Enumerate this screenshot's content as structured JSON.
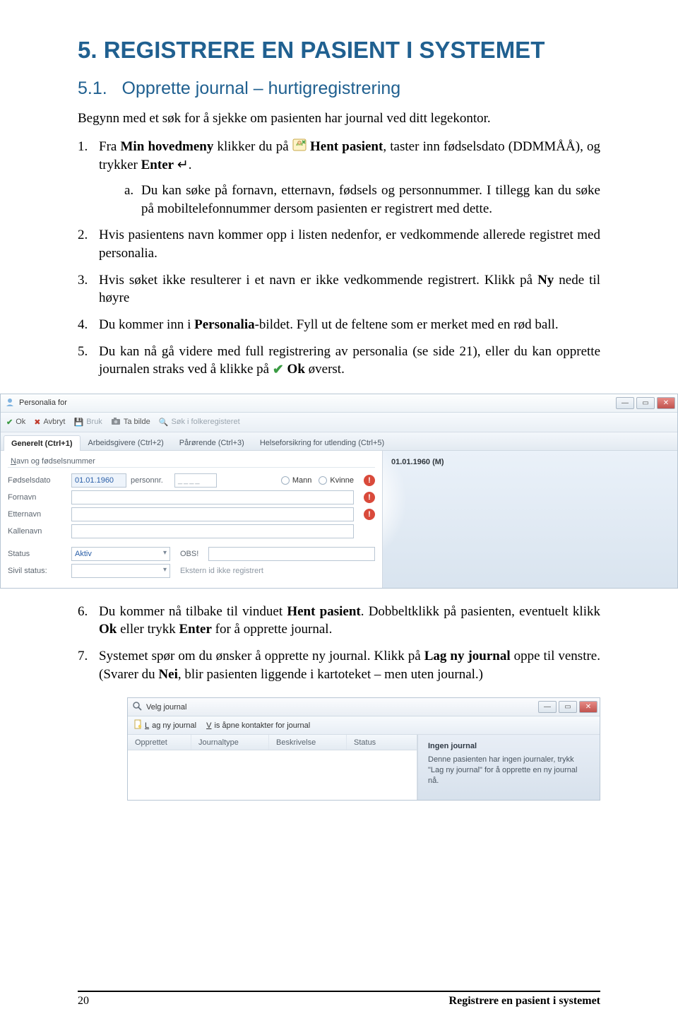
{
  "chapter": {
    "number": "5.",
    "title": "REGISTRERE EN PASIENT I SYSTEMET"
  },
  "section": {
    "number": "5.1.",
    "title": "Opprette journal – hurtigregistrering"
  },
  "intro": "Begynn med et søk for å sjekke om pasienten har journal ved ditt legekontor.",
  "steps1": {
    "s1_a": "Fra ",
    "s1_b": "Min hovedmeny",
    "s1_c": " klikker du på ",
    "s1_d": "Hent pasient",
    "s1_e": ", taster inn fødselsdato (DDMMÅÅ), og trykker ",
    "s1_f": "Enter",
    "s1_g": " ↵.",
    "s1a": "Du kan søke på fornavn, etternavn, fødsels og personnummer. I tillegg kan du søke på mobiltelefonnummer dersom pasienten er registrert med dette.",
    "s2": "Hvis pasientens navn kommer opp i listen nedenfor, er vedkommende allerede registret med personalia.",
    "s3_a": "Hvis søket ikke resulterer i et navn er ikke vedkommende registrert. Klikk på ",
    "s3_b": "Ny",
    "s3_c": " nede til høyre",
    "s4_a": "Du kommer inn i ",
    "s4_b": "Personalia",
    "s4_c": "-bildet. Fyll ut de feltene som er merket med en rød ball.",
    "s5_a": "Du kan nå gå videre med full registrering av personalia (se side 21), eller du kan opprette journalen straks ved å klikke på ",
    "s5_b": "Ok",
    "s5_c": " øverst."
  },
  "steps2": {
    "s6_a": "Du kommer nå tilbake til vinduet ",
    "s6_b": "Hent pasient",
    "s6_c": ". Dobbeltklikk på pasienten, eventuelt klikk ",
    "s6_d": "Ok",
    "s6_e": " eller trykk ",
    "s6_f": "Enter",
    "s6_g": " for å opprette journal.",
    "s7_a": "Systemet spør om du ønsker å opprette ny journal. Klikk på ",
    "s7_b": "Lag ny journal",
    "s7_c": " oppe til venstre. (Svarer du ",
    "s7_d": "Nei",
    "s7_e": ", blir pasienten liggende i kartoteket – men uten journal.)"
  },
  "personalia": {
    "title": "Personalia for",
    "toolbar": {
      "ok": "Ok",
      "avbryt": "Avbryt",
      "bruk": "Bruk",
      "tabilde": "Ta bilde",
      "folkereg": "Søk i folkeregisteret"
    },
    "tabs": {
      "generelt": "Generelt (Ctrl+1)",
      "arbeidsgivere": "Arbeidsgivere (Ctrl+2)",
      "parorende": "Pårørende (Ctrl+3)",
      "helseforsikring": "Helseforsikring for utlending (Ctrl+5)"
    },
    "group": "Navn og fødselsnummer",
    "labels": {
      "fodselsdato": "Fødselsdato",
      "personnr": "personnr.",
      "fornavn": "Fornavn",
      "etternavn": "Etternavn",
      "kallenavn": "Kallenavn",
      "status": "Status",
      "sivil": "Sivil status:",
      "obs": "OBS!",
      "ekstern": "Ekstern id ikke registrert",
      "mann": "Mann",
      "kvinne": "Kvinne"
    },
    "values": {
      "fodselsdato": "01.01.1960",
      "status": "Aktiv",
      "display": "01.01.1960 (M)"
    }
  },
  "velgjournal": {
    "title": "Velg journal",
    "toolbar": {
      "lagny": "Lag ny journal",
      "visapne": "Vis åpne kontakter for journal"
    },
    "cols": {
      "opprettet": "Opprettet",
      "journaltype": "Journaltype",
      "beskrivelse": "Beskrivelse",
      "status": "Status"
    },
    "panel": {
      "head": "Ingen journal",
      "body": "Denne pasienten har ingen journaler, trykk \"Lag ny journal\" for å opprette en ny journal nå."
    }
  },
  "footer": {
    "page": "20",
    "right": "Registrere en pasient i systemet"
  }
}
